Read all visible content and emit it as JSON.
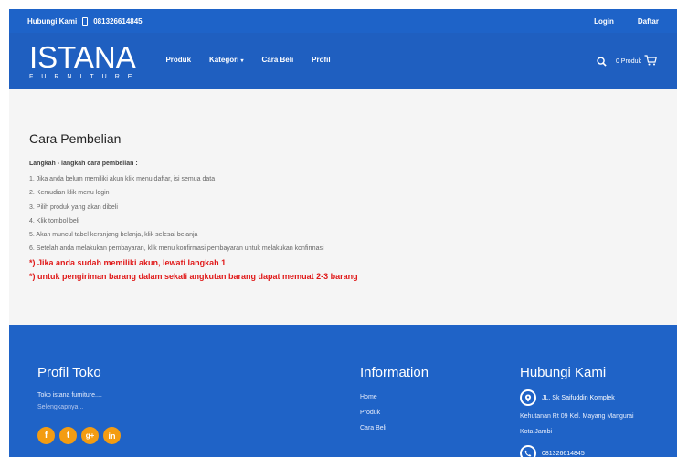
{
  "topbar": {
    "contact_label": "Hubungi Kami",
    "phone": "081326614845",
    "login": "Login",
    "register": "Daftar"
  },
  "nav": {
    "logo_main": "ISTANA",
    "logo_sub": "FURNITURE",
    "items": [
      {
        "label": "Produk"
      },
      {
        "label": "Kategori"
      },
      {
        "label": "Cara Beli"
      },
      {
        "label": "Profil"
      }
    ],
    "cart_label": "0 Produk"
  },
  "main": {
    "title": "Cara Pembelian",
    "subtitle": "Langkah - langkah cara pembelian :",
    "steps": [
      "1. Jika anda belum memiliki akun klik menu daftar, isi semua data",
      "2. Kemudian klik menu login",
      "3. Pilih produk yang akan dibeli",
      "4. Klik tombol beli",
      "5. Akan muncul tabel keranjang belanja, klik selesai belanja",
      "6. Setelah anda melakukan pembayaran, klik menu konfirmasi pembayaran untuk melakukan konfirmasi"
    ],
    "notes": [
      "*) Jika anda sudah memiliki akun, lewati langkah 1",
      "*) untuk pengiriman barang dalam sekali angkutan barang dapat memuat 2-3 barang"
    ]
  },
  "footer": {
    "profil": {
      "title": "Profil Toko",
      "text": "Toko istana furniture....",
      "more": "Selengkapnya..."
    },
    "info": {
      "title": "Information",
      "links": [
        "Home",
        "Produk",
        "Cara Beli"
      ]
    },
    "hubungi": {
      "title": "Hubungi Kami",
      "address_line1": "JL. Sk Saifuddin Komplek",
      "address_line2": "Kehutanan Rt 09 Kel. Mayang Mangurai",
      "address_line3": "Kota Jambi",
      "phone": "081326614845"
    }
  },
  "colors": {
    "topbar": "#1e63c8",
    "navbar": "#1f5fc0",
    "footer": "#1f63c7",
    "note_red": "#e01919",
    "social_orange": "#f39c12"
  }
}
